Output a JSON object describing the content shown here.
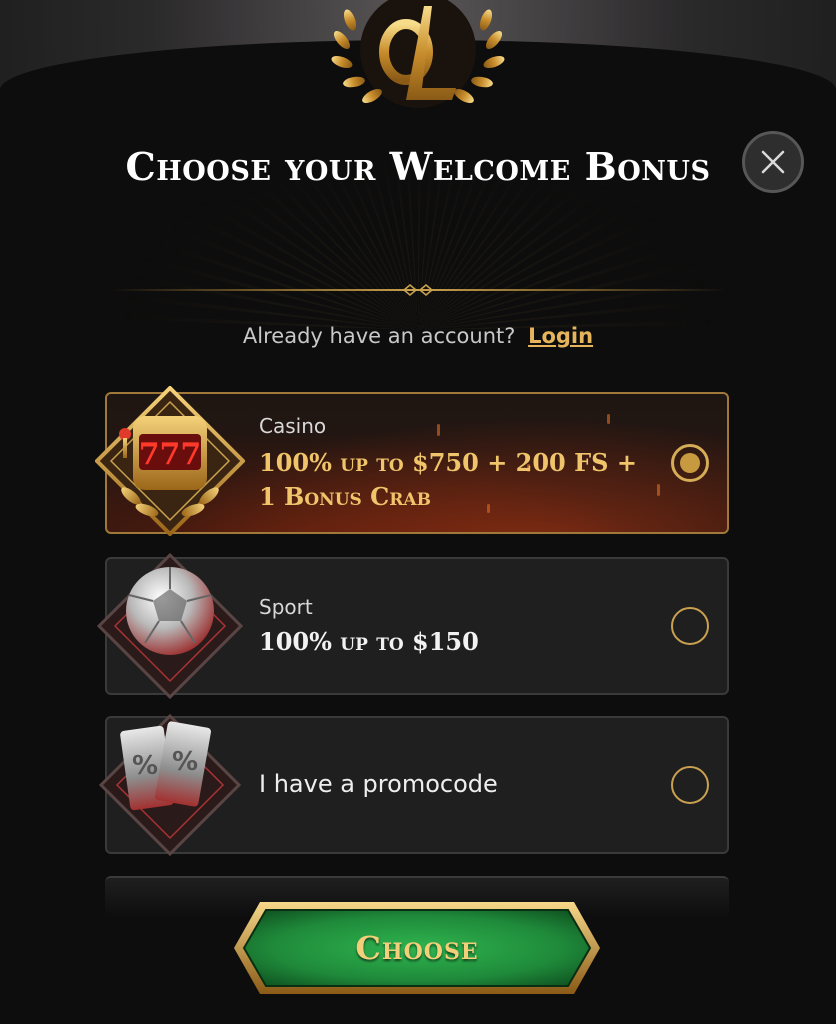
{
  "modal": {
    "title": "Choose your Welcome Bonus",
    "logo_letters": "OL",
    "close_icon": "close-icon"
  },
  "account": {
    "prompt": "Already have an account?",
    "login_label": "Login"
  },
  "options": [
    {
      "label": "Casino",
      "value": "100% up to $750 + 200 FS + 1 Bonus Crab",
      "icon": "slot-machine-icon",
      "selected": true
    },
    {
      "label": "Sport",
      "value": "100% up to $150",
      "icon": "soccer-ball-icon",
      "selected": false
    },
    {
      "label": "I have a promocode",
      "icon": "promo-ticket-icon",
      "selected": false
    }
  ],
  "cta": {
    "label": "Choose",
    "color": "#1f8a3a"
  },
  "colors": {
    "gold": "#c9a14f",
    "background": "#0d0d0d"
  }
}
